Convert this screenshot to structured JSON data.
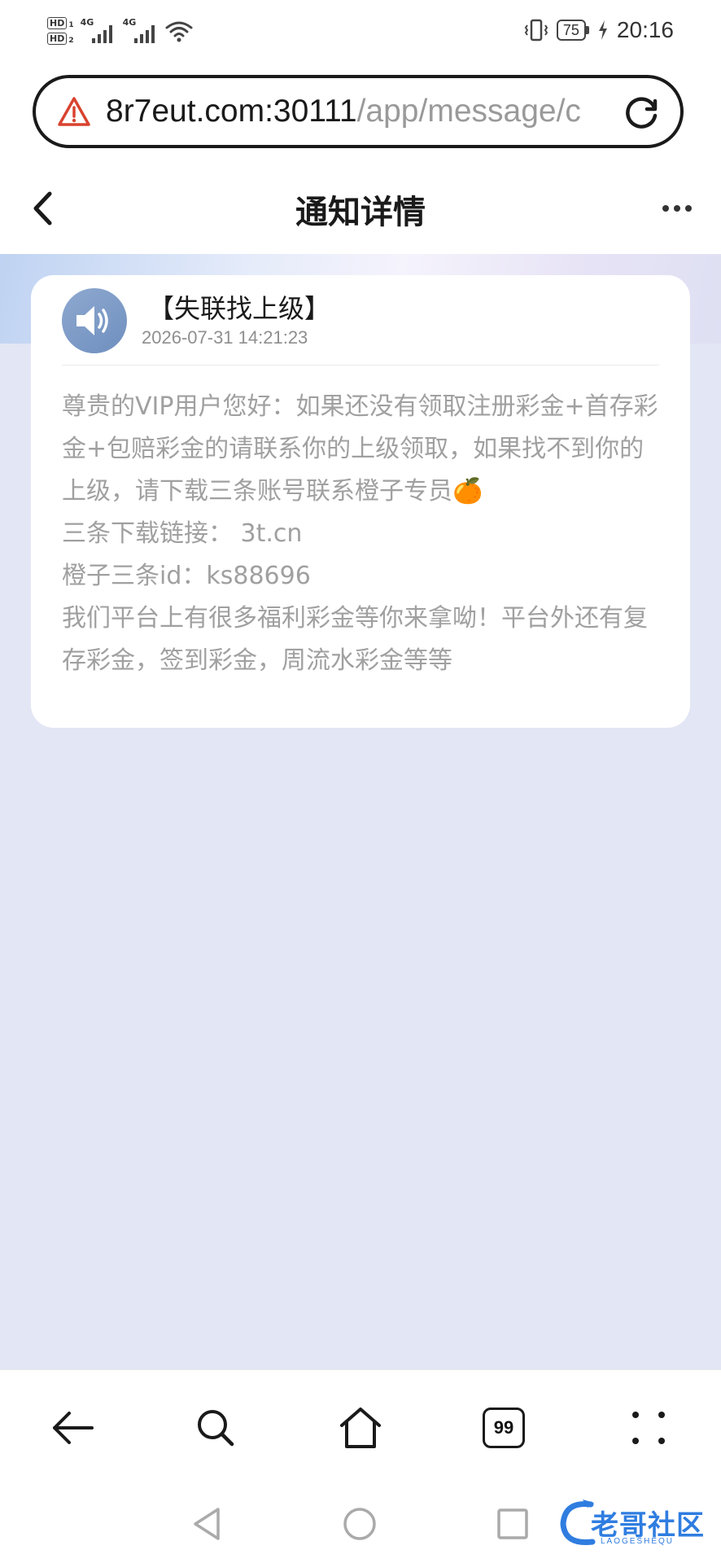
{
  "status_bar": {
    "sim1": "HD",
    "sim1_index": "1",
    "sim2": "HD",
    "sim2_index": "2",
    "net1": "4G",
    "net2": "4G",
    "battery": "75",
    "time": "20:16"
  },
  "address_bar": {
    "host": "8r7eut.com:30111",
    "path": "/app/message/c"
  },
  "header": {
    "title": "通知详情"
  },
  "notice": {
    "title": "【失联找上级】",
    "timestamp": "2026-07-31 14:21:23",
    "body": [
      "尊贵的VIP用户您好：如果还没有领取注册彩金+首存彩金+包赔彩金的请联系你的上级领取，如果找不到你的上级，请下载三条账号联系橙子专员🍊",
      "三条下载链接： 3t.cn",
      "橙子三条id：ks88696",
      "我们平台上有很多福利彩金等你来拿呦！平台外还有复存彩金，签到彩金，周流水彩金等等"
    ]
  },
  "toolbar": {
    "tabs_count": "99"
  },
  "watermark": {
    "text": "老哥社区",
    "sub": "LAOGESHEQU"
  }
}
